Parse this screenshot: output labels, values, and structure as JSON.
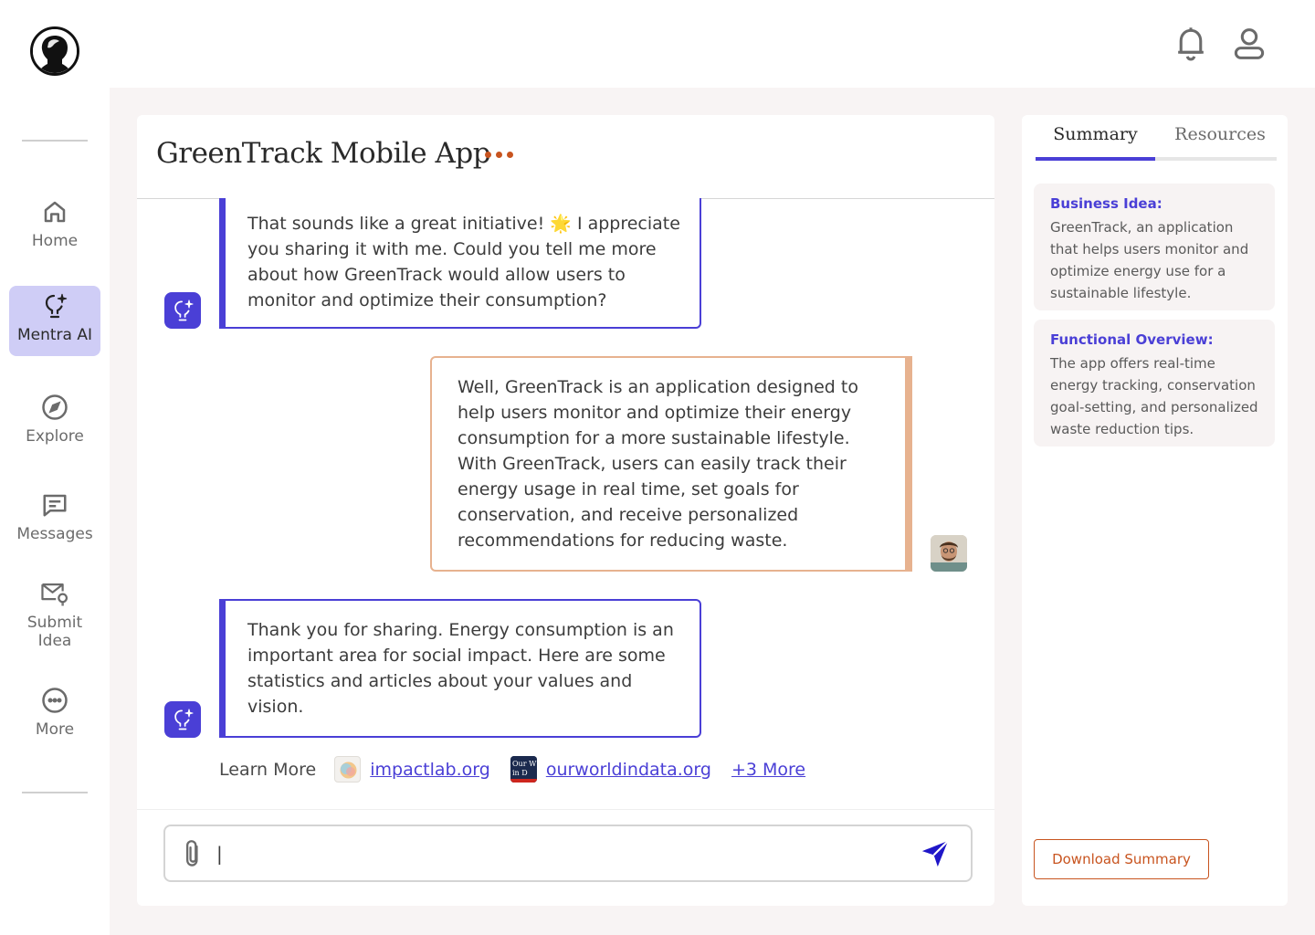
{
  "sidebar": {
    "items": [
      {
        "label": "Home",
        "icon": "home-icon"
      },
      {
        "label": "Mentra AI",
        "icon": "lightbulb-sparkle-icon",
        "active": true
      },
      {
        "label": "Explore",
        "icon": "compass-icon"
      },
      {
        "label": "Messages",
        "icon": "message-icon"
      },
      {
        "label": "Submit\nIdea",
        "icon": "mail-idea-icon"
      },
      {
        "label": "More",
        "icon": "more-circle-icon"
      }
    ]
  },
  "chat": {
    "title": "GreenTrack Mobile App",
    "messages": [
      {
        "role": "ai",
        "text": "That sounds like a great initiative! 🌟 I appreciate you sharing it with me. Could you tell me more about how GreenTrack would allow users to monitor and optimize their consumption?"
      },
      {
        "role": "user",
        "text": "Well, GreenTrack is an application designed to help users monitor and optimize their energy consumption for a more sustainable lifestyle. With GreenTrack, users can easily track their energy usage in real time, set goals for conservation, and receive personalized recommendations for reducing waste."
      },
      {
        "role": "ai",
        "text": "Thank you for sharing. Energy consumption is an important area for social impact. Here are some statistics and articles about your values and vision."
      }
    ],
    "learn_more": {
      "label": "Learn More",
      "sources": [
        "impactlab.org",
        "ourworldindata.org"
      ],
      "more": "+3 More"
    },
    "composer": {
      "value": "|"
    }
  },
  "side_panel": {
    "tabs": [
      "Summary",
      "Resources"
    ],
    "active_tab": "Summary",
    "sections": [
      {
        "title": "Business Idea:",
        "text": "GreenTrack, an application that helps users monitor and optimize energy use for a sustainable lifestyle."
      },
      {
        "title": "Functional Overview:",
        "text": "The app offers real-time energy tracking, conservation goal-setting, and personalized waste reduction tips."
      }
    ],
    "download_label": "Download Summary"
  },
  "colors": {
    "accent": "#4a3fd6",
    "user_bubble_border": "#e7b28f",
    "orange": "#c8541f",
    "active_nav": "#cfcdf6",
    "panel_bg": "#f8f4f4"
  }
}
